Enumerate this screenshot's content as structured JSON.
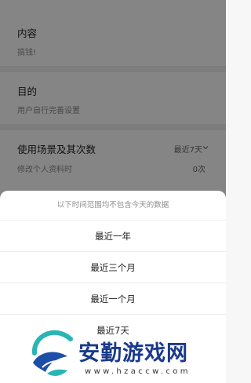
{
  "content_section": {
    "title": "内容",
    "value": "搞钱!"
  },
  "purpose_section": {
    "title": "目的",
    "value": "用户自行完善设置"
  },
  "usage_section": {
    "title": "使用场景及其次数",
    "range_label": "最近7天",
    "scene": "修改个人资料时",
    "count": "0次"
  },
  "sheet": {
    "hint": "以下时间范围均不包含今天的数据",
    "options": [
      "最近一年",
      "最近三个月",
      "最近一个月",
      "最近7天"
    ]
  },
  "watermark": {
    "title": "安勤游戏网",
    "url": "www.hzaccw.com"
  }
}
